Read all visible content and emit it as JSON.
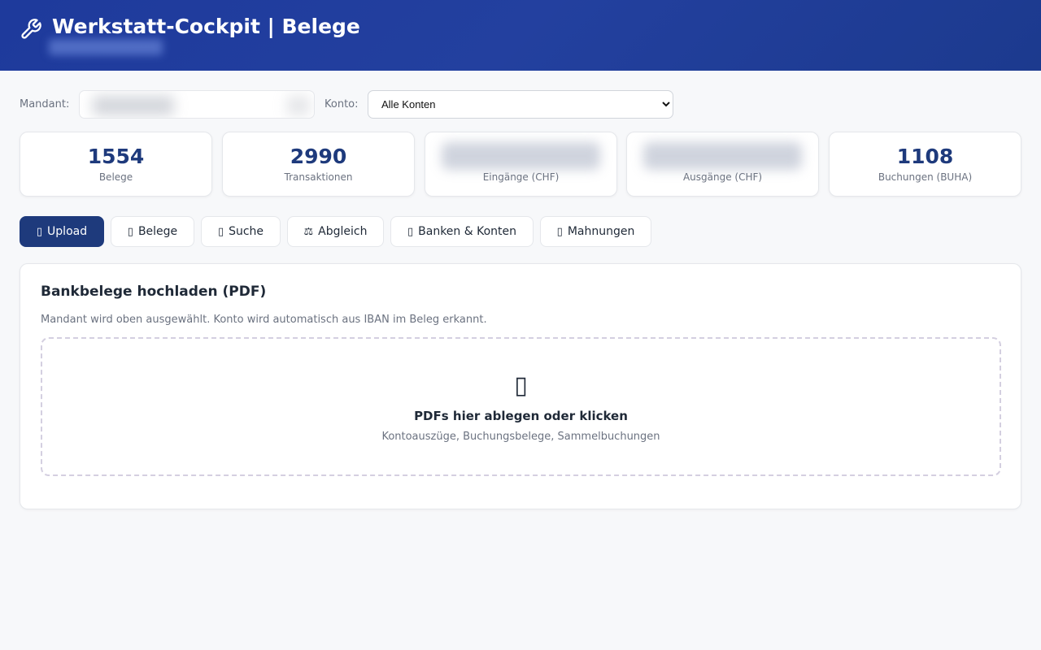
{
  "header": {
    "title": "Werkstatt-Cockpit | Belege",
    "icon": "wrench-icon"
  },
  "filters": {
    "mandant_label": "Mandant:",
    "konto_label": "Konto:",
    "konto_selected": "Alle Konten"
  },
  "stats": [
    {
      "value": "1554",
      "label": "Belege"
    },
    {
      "value": "2990",
      "label": "Transaktionen"
    },
    {
      "value": "",
      "label": "Eingänge (CHF)"
    },
    {
      "value": "",
      "label": "Ausgänge (CHF)"
    },
    {
      "value": "1108",
      "label": "Buchungen (BUHA)"
    }
  ],
  "tabs": [
    {
      "label": "Upload",
      "glyph": "▯",
      "active": true
    },
    {
      "label": "Belege",
      "glyph": "▯"
    },
    {
      "label": "Suche",
      "glyph": "▯"
    },
    {
      "label": "Abgleich",
      "glyph": "⚖"
    },
    {
      "label": "Banken & Konten",
      "glyph": "▯"
    },
    {
      "label": "Mahnungen",
      "glyph": "▯"
    }
  ],
  "upload": {
    "title": "Bankbelege hochladen (PDF)",
    "hint": "Mandant wird oben ausgewählt. Konto wird automatisch aus IBAN im Beleg erkannt.",
    "dropzone_icon": "▯",
    "dropzone_title": "PDFs hier ablegen oder klicken",
    "dropzone_sub": "Kontoauszüge, Buchungsbelege, Sammelbuchungen"
  },
  "colors": {
    "header": "#1e3a9c",
    "accent": "#1e3a7c"
  }
}
